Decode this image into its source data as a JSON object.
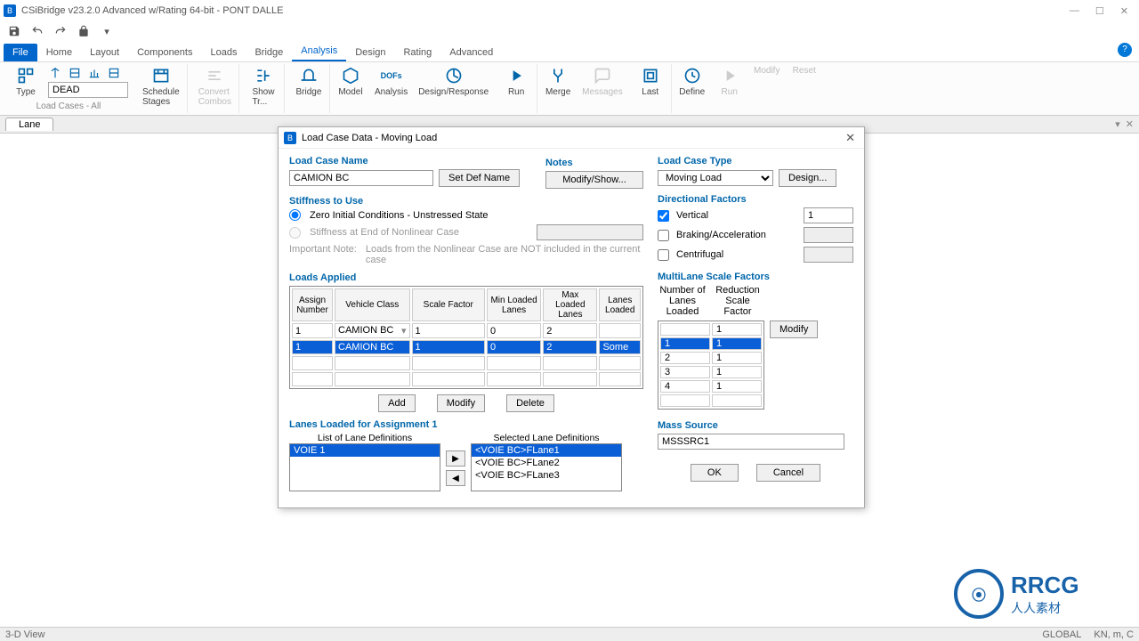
{
  "window": {
    "title": "CSiBridge v23.2.0 Advanced w/Rating 64-bit - PONT DALLE",
    "icon_letter": "B"
  },
  "qat": {
    "save": "save",
    "undo": "undo",
    "redo": "redo",
    "lock": "lock",
    "more": "more"
  },
  "tabs": {
    "file": "File",
    "home": "Home",
    "layout": "Layout",
    "components": "Components",
    "loads": "Loads",
    "bridge": "Bridge",
    "analysis": "Analysis",
    "design": "Design",
    "rating": "Rating",
    "advanced": "Advanced"
  },
  "ribbon": {
    "type": "Type",
    "type_select": "DEAD",
    "schedule_stages": "Schedule\nStages",
    "convert_combos": "Convert\nCombos",
    "show_tree": "Show\nTr...",
    "bridge": "Bridge",
    "model": "Model",
    "dofs": "DOFs",
    "analysis": "Analysis",
    "design_response": "Design/Response",
    "run": "Run",
    "merge": "Merge",
    "messages": "Messages",
    "last": "Last",
    "define": "Define",
    "run2": "Run",
    "modify": "Modify",
    "reset": "Reset",
    "group_load_cases": "Load Cases - All"
  },
  "doc_tab": {
    "name": "Lane"
  },
  "status": {
    "left": "3-D View",
    "right1": "GLOBAL",
    "right2": "KN, m, C"
  },
  "dialog": {
    "title": "Load Case Data - Moving Load",
    "icon_letter": "B",
    "lcn_label": "Load Case Name",
    "lcn_value": "CAMION BC",
    "setdef_btn": "Set Def Name",
    "notes_label": "Notes",
    "notes_btn": "Modify/Show...",
    "lct_label": "Load Case Type",
    "lct_value": "Moving Load",
    "design_btn": "Design...",
    "stiffness_label": "Stiffness to Use",
    "stiff_opt1": "Zero Initial Conditions - Unstressed State",
    "stiff_opt2": "Stiffness at End of Nonlinear Case",
    "stiff_note_label": "Important Note:",
    "stiff_note": "Loads from the Nonlinear Case are NOT included in the current case",
    "dirfac_label": "Directional Factors",
    "df_vertical": "Vertical",
    "df_vertical_val": "1",
    "df_braking": "Braking/Acceleration",
    "df_centrifugal": "Centrifugal",
    "loads_applied": "Loads Applied",
    "th_assign": "Assign\nNumber",
    "th_vclass": "Vehicle Class",
    "th_scale": "Scale Factor",
    "th_minlanes": "Min Loaded\nLanes",
    "th_maxlanes": "Max Loaded\nLanes",
    "th_lanesloaded": "Lanes\nLoaded",
    "row1": {
      "assign": "1",
      "vclass": "CAMION BC",
      "scale": "1",
      "min": "0",
      "max": "2",
      "lanes": ""
    },
    "row2": {
      "assign": "1",
      "vclass": "CAMION BC",
      "scale": "1",
      "min": "0",
      "max": "2",
      "lanes": "Some"
    },
    "add_btn": "Add",
    "modify_btn": "Modify",
    "delete_btn": "Delete",
    "lanes_assignment_label": "Lanes Loaded for Assignment 1",
    "list_lane_label": "List of Lane Definitions",
    "selected_lane_label": "Selected Lane Definitions",
    "voie1": "VOIE 1",
    "sel_lanes": [
      "<VOIE BC>FLane1",
      "<VOIE BC>FLane2",
      "<VOIE BC>FLane3"
    ],
    "multiscale_label": "MultiLane Scale Factors",
    "ms_head1": "Number of\nLanes\nLoaded",
    "ms_head2": "Reduction Scale\nFactor",
    "ms_topvalue": "1",
    "ms_rows": [
      {
        "n": "1",
        "f": "1"
      },
      {
        "n": "2",
        "f": "1"
      },
      {
        "n": "3",
        "f": "1"
      },
      {
        "n": "4",
        "f": "1"
      }
    ],
    "ms_modify": "Modify",
    "mass_label": "Mass Source",
    "mass_value": "MSSSRC1",
    "ok": "OK",
    "cancel": "Cancel"
  },
  "watermark": {
    "brand": "RRCG",
    "sub": "人人素材"
  }
}
